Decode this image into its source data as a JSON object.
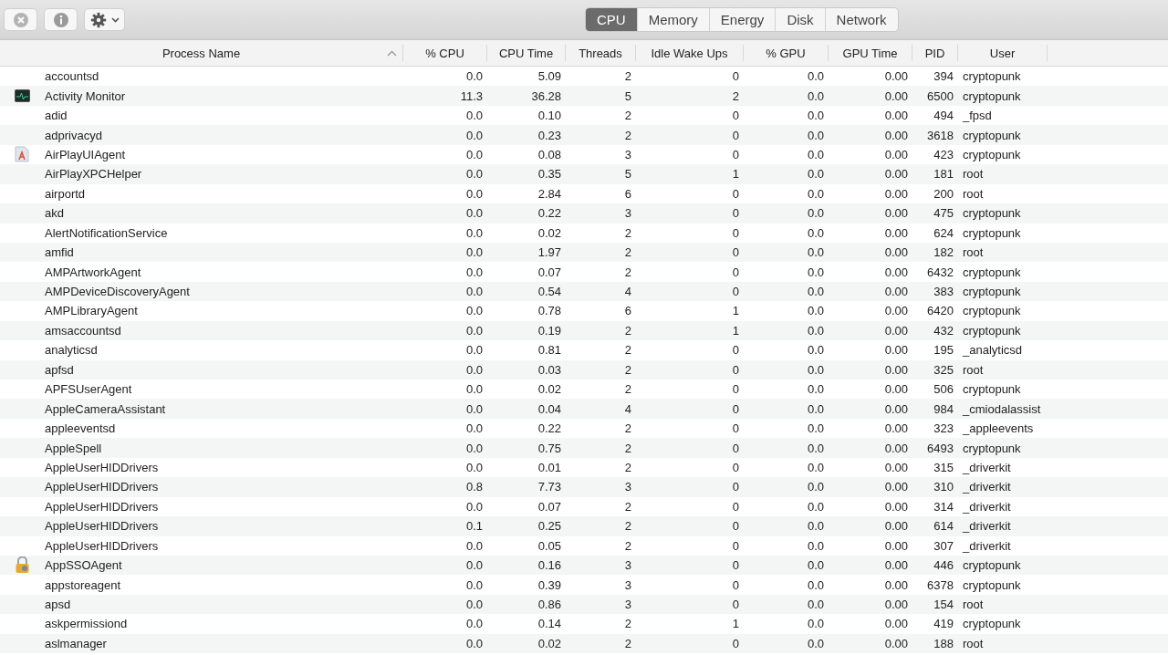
{
  "toolbar": {
    "tabs": [
      {
        "label": "CPU",
        "selected": true
      },
      {
        "label": "Memory",
        "selected": false
      },
      {
        "label": "Energy",
        "selected": false
      },
      {
        "label": "Disk",
        "selected": false
      },
      {
        "label": "Network",
        "selected": false
      }
    ]
  },
  "table": {
    "columns": [
      {
        "label": "Process Name"
      },
      {
        "label": "% CPU"
      },
      {
        "label": "CPU Time"
      },
      {
        "label": "Threads"
      },
      {
        "label": "Idle Wake Ups"
      },
      {
        "label": "% GPU"
      },
      {
        "label": "GPU Time"
      },
      {
        "label": "PID"
      },
      {
        "label": "User"
      }
    ],
    "rows": [
      {
        "kind": "plain",
        "cells": [
          "accountsd",
          "0.0",
          "5.09",
          "2",
          "0",
          "0.0",
          "0.00",
          "394",
          "cryptopunk"
        ]
      },
      {
        "kind": "monitor",
        "cells": [
          "Activity Monitor",
          "11.3",
          "36.28",
          "5",
          "2",
          "0.0",
          "0.00",
          "6500",
          "cryptopunk"
        ]
      },
      {
        "kind": "plain",
        "cells": [
          "adid",
          "0.0",
          "0.10",
          "2",
          "0",
          "0.0",
          "0.00",
          "494",
          "_fpsd"
        ]
      },
      {
        "kind": "plain",
        "cells": [
          "adprivacyd",
          "0.0",
          "0.23",
          "2",
          "0",
          "0.0",
          "0.00",
          "3618",
          "cryptopunk"
        ]
      },
      {
        "kind": "document",
        "cells": [
          "AirPlayUIAgent",
          "0.0",
          "0.08",
          "3",
          "0",
          "0.0",
          "0.00",
          "423",
          "cryptopunk"
        ]
      },
      {
        "kind": "plain",
        "cells": [
          "AirPlayXPCHelper",
          "0.0",
          "0.35",
          "5",
          "1",
          "0.0",
          "0.00",
          "181",
          "root"
        ]
      },
      {
        "kind": "plain",
        "cells": [
          "airportd",
          "0.0",
          "2.84",
          "6",
          "0",
          "0.0",
          "0.00",
          "200",
          "root"
        ]
      },
      {
        "kind": "plain",
        "cells": [
          "akd",
          "0.0",
          "0.22",
          "3",
          "0",
          "0.0",
          "0.00",
          "475",
          "cryptopunk"
        ]
      },
      {
        "kind": "plain",
        "cells": [
          "AlertNotificationService",
          "0.0",
          "0.02",
          "2",
          "0",
          "0.0",
          "0.00",
          "624",
          "cryptopunk"
        ]
      },
      {
        "kind": "plain",
        "cells": [
          "amfid",
          "0.0",
          "1.97",
          "2",
          "0",
          "0.0",
          "0.00",
          "182",
          "root"
        ]
      },
      {
        "kind": "plain",
        "cells": [
          "AMPArtworkAgent",
          "0.0",
          "0.07",
          "2",
          "0",
          "0.0",
          "0.00",
          "6432",
          "cryptopunk"
        ]
      },
      {
        "kind": "plain",
        "cells": [
          "AMPDeviceDiscoveryAgent",
          "0.0",
          "0.54",
          "4",
          "0",
          "0.0",
          "0.00",
          "383",
          "cryptopunk"
        ]
      },
      {
        "kind": "plain",
        "cells": [
          "AMPLibraryAgent",
          "0.0",
          "0.78",
          "6",
          "1",
          "0.0",
          "0.00",
          "6420",
          "cryptopunk"
        ]
      },
      {
        "kind": "plain",
        "cells": [
          "amsaccountsd",
          "0.0",
          "0.19",
          "2",
          "1",
          "0.0",
          "0.00",
          "432",
          "cryptopunk"
        ]
      },
      {
        "kind": "plain",
        "cells": [
          "analyticsd",
          "0.0",
          "0.81",
          "2",
          "0",
          "0.0",
          "0.00",
          "195",
          "_analyticsd"
        ]
      },
      {
        "kind": "plain",
        "cells": [
          "apfsd",
          "0.0",
          "0.03",
          "2",
          "0",
          "0.0",
          "0.00",
          "325",
          "root"
        ]
      },
      {
        "kind": "plain",
        "cells": [
          "APFSUserAgent",
          "0.0",
          "0.02",
          "2",
          "0",
          "0.0",
          "0.00",
          "506",
          "cryptopunk"
        ]
      },
      {
        "kind": "plain",
        "cells": [
          "AppleCameraAssistant",
          "0.0",
          "0.04",
          "4",
          "0",
          "0.0",
          "0.00",
          "984",
          "_cmiodalassist"
        ]
      },
      {
        "kind": "plain",
        "cells": [
          "appleeventsd",
          "0.0",
          "0.22",
          "2",
          "0",
          "0.0",
          "0.00",
          "323",
          "_appleevents"
        ]
      },
      {
        "kind": "plain",
        "cells": [
          "AppleSpell",
          "0.0",
          "0.75",
          "2",
          "0",
          "0.0",
          "0.00",
          "6493",
          "cryptopunk"
        ]
      },
      {
        "kind": "plain",
        "cells": [
          "AppleUserHIDDrivers",
          "0.0",
          "0.01",
          "2",
          "0",
          "0.0",
          "0.00",
          "315",
          "_driverkit"
        ]
      },
      {
        "kind": "plain",
        "cells": [
          "AppleUserHIDDrivers",
          "0.8",
          "7.73",
          "3",
          "0",
          "0.0",
          "0.00",
          "310",
          "_driverkit"
        ]
      },
      {
        "kind": "plain",
        "cells": [
          "AppleUserHIDDrivers",
          "0.0",
          "0.07",
          "2",
          "0",
          "0.0",
          "0.00",
          "314",
          "_driverkit"
        ]
      },
      {
        "kind": "plain",
        "cells": [
          "AppleUserHIDDrivers",
          "0.1",
          "0.25",
          "2",
          "0",
          "0.0",
          "0.00",
          "614",
          "_driverkit"
        ]
      },
      {
        "kind": "plain",
        "cells": [
          "AppleUserHIDDrivers",
          "0.0",
          "0.05",
          "2",
          "0",
          "0.0",
          "0.00",
          "307",
          "_driverkit"
        ]
      },
      {
        "kind": "lock",
        "cells": [
          "AppSSOAgent",
          "0.0",
          "0.16",
          "3",
          "0",
          "0.0",
          "0.00",
          "446",
          "cryptopunk"
        ]
      },
      {
        "kind": "plain",
        "cells": [
          "appstoreagent",
          "0.0",
          "0.39",
          "3",
          "0",
          "0.0",
          "0.00",
          "6378",
          "cryptopunk"
        ]
      },
      {
        "kind": "plain",
        "cells": [
          "apsd",
          "0.0",
          "0.86",
          "3",
          "0",
          "0.0",
          "0.00",
          "154",
          "root"
        ]
      },
      {
        "kind": "plain",
        "cells": [
          "askpermissiond",
          "0.0",
          "0.14",
          "2",
          "1",
          "0.0",
          "0.00",
          "419",
          "cryptopunk"
        ]
      },
      {
        "kind": "plain",
        "cells": [
          "aslmanager",
          "0.0",
          "0.02",
          "2",
          "0",
          "0.0",
          "0.00",
          "188",
          "root"
        ]
      }
    ]
  }
}
